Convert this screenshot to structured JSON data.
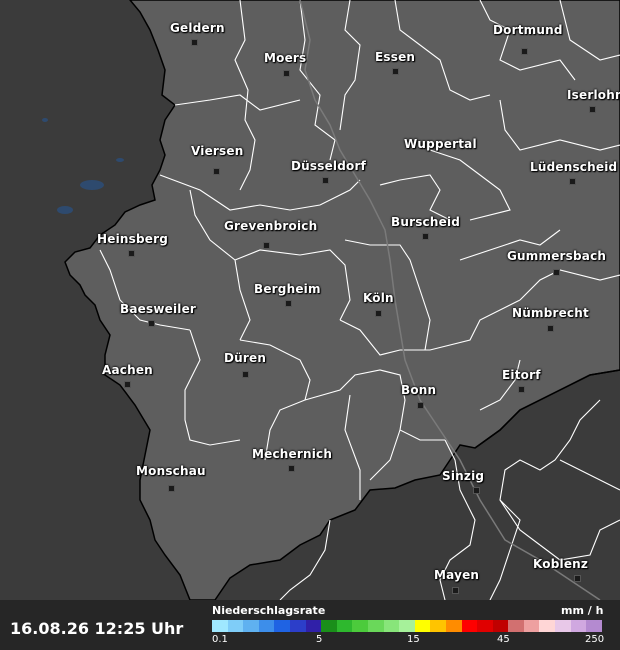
{
  "timestamp": "16.08.26 12:25 Uhr",
  "legend": {
    "title": "Niederschlagsrate",
    "unit": "mm / h",
    "ticks": [
      "0.1",
      "5",
      "15",
      "45",
      "250"
    ],
    "colors": [
      "#9fe8ff",
      "#7fcdf8",
      "#5fb1f0",
      "#3d8eea",
      "#1f63e3",
      "#2c3ec9",
      "#3020a8",
      "#1a8f1a",
      "#2eb82e",
      "#4ccb3c",
      "#6ad85a",
      "#88e57a",
      "#a6f19a",
      "#ffff00",
      "#ffc400",
      "#ff8c00",
      "#ff0000",
      "#e00000",
      "#c00000",
      "#d27070",
      "#eea0a0",
      "#ffd6d6",
      "#e8c8e8",
      "#d0a8e0",
      "#b48ad0"
    ]
  },
  "cities": [
    {
      "name": "Geldern"
    },
    {
      "name": "Moers"
    },
    {
      "name": "Essen"
    },
    {
      "name": "Dortmund"
    },
    {
      "name": "Iserlohn"
    },
    {
      "name": "Viersen"
    },
    {
      "name": "Düsseldorf"
    },
    {
      "name": "Wuppertal"
    },
    {
      "name": "Lüdenscheid"
    },
    {
      "name": "Grevenbroich"
    },
    {
      "name": "Burscheid"
    },
    {
      "name": "Heinsberg"
    },
    {
      "name": "Gummersbach"
    },
    {
      "name": "Bergheim"
    },
    {
      "name": "Köln"
    },
    {
      "name": "Baesweiler"
    },
    {
      "name": "Nümbrecht"
    },
    {
      "name": "Düren"
    },
    {
      "name": "Aachen"
    },
    {
      "name": "Eitorf"
    },
    {
      "name": "Bonn"
    },
    {
      "name": "Mechernich"
    },
    {
      "name": "Monschau"
    },
    {
      "name": "Sinzig"
    },
    {
      "name": "Koblenz"
    },
    {
      "name": "Mayen"
    }
  ]
}
